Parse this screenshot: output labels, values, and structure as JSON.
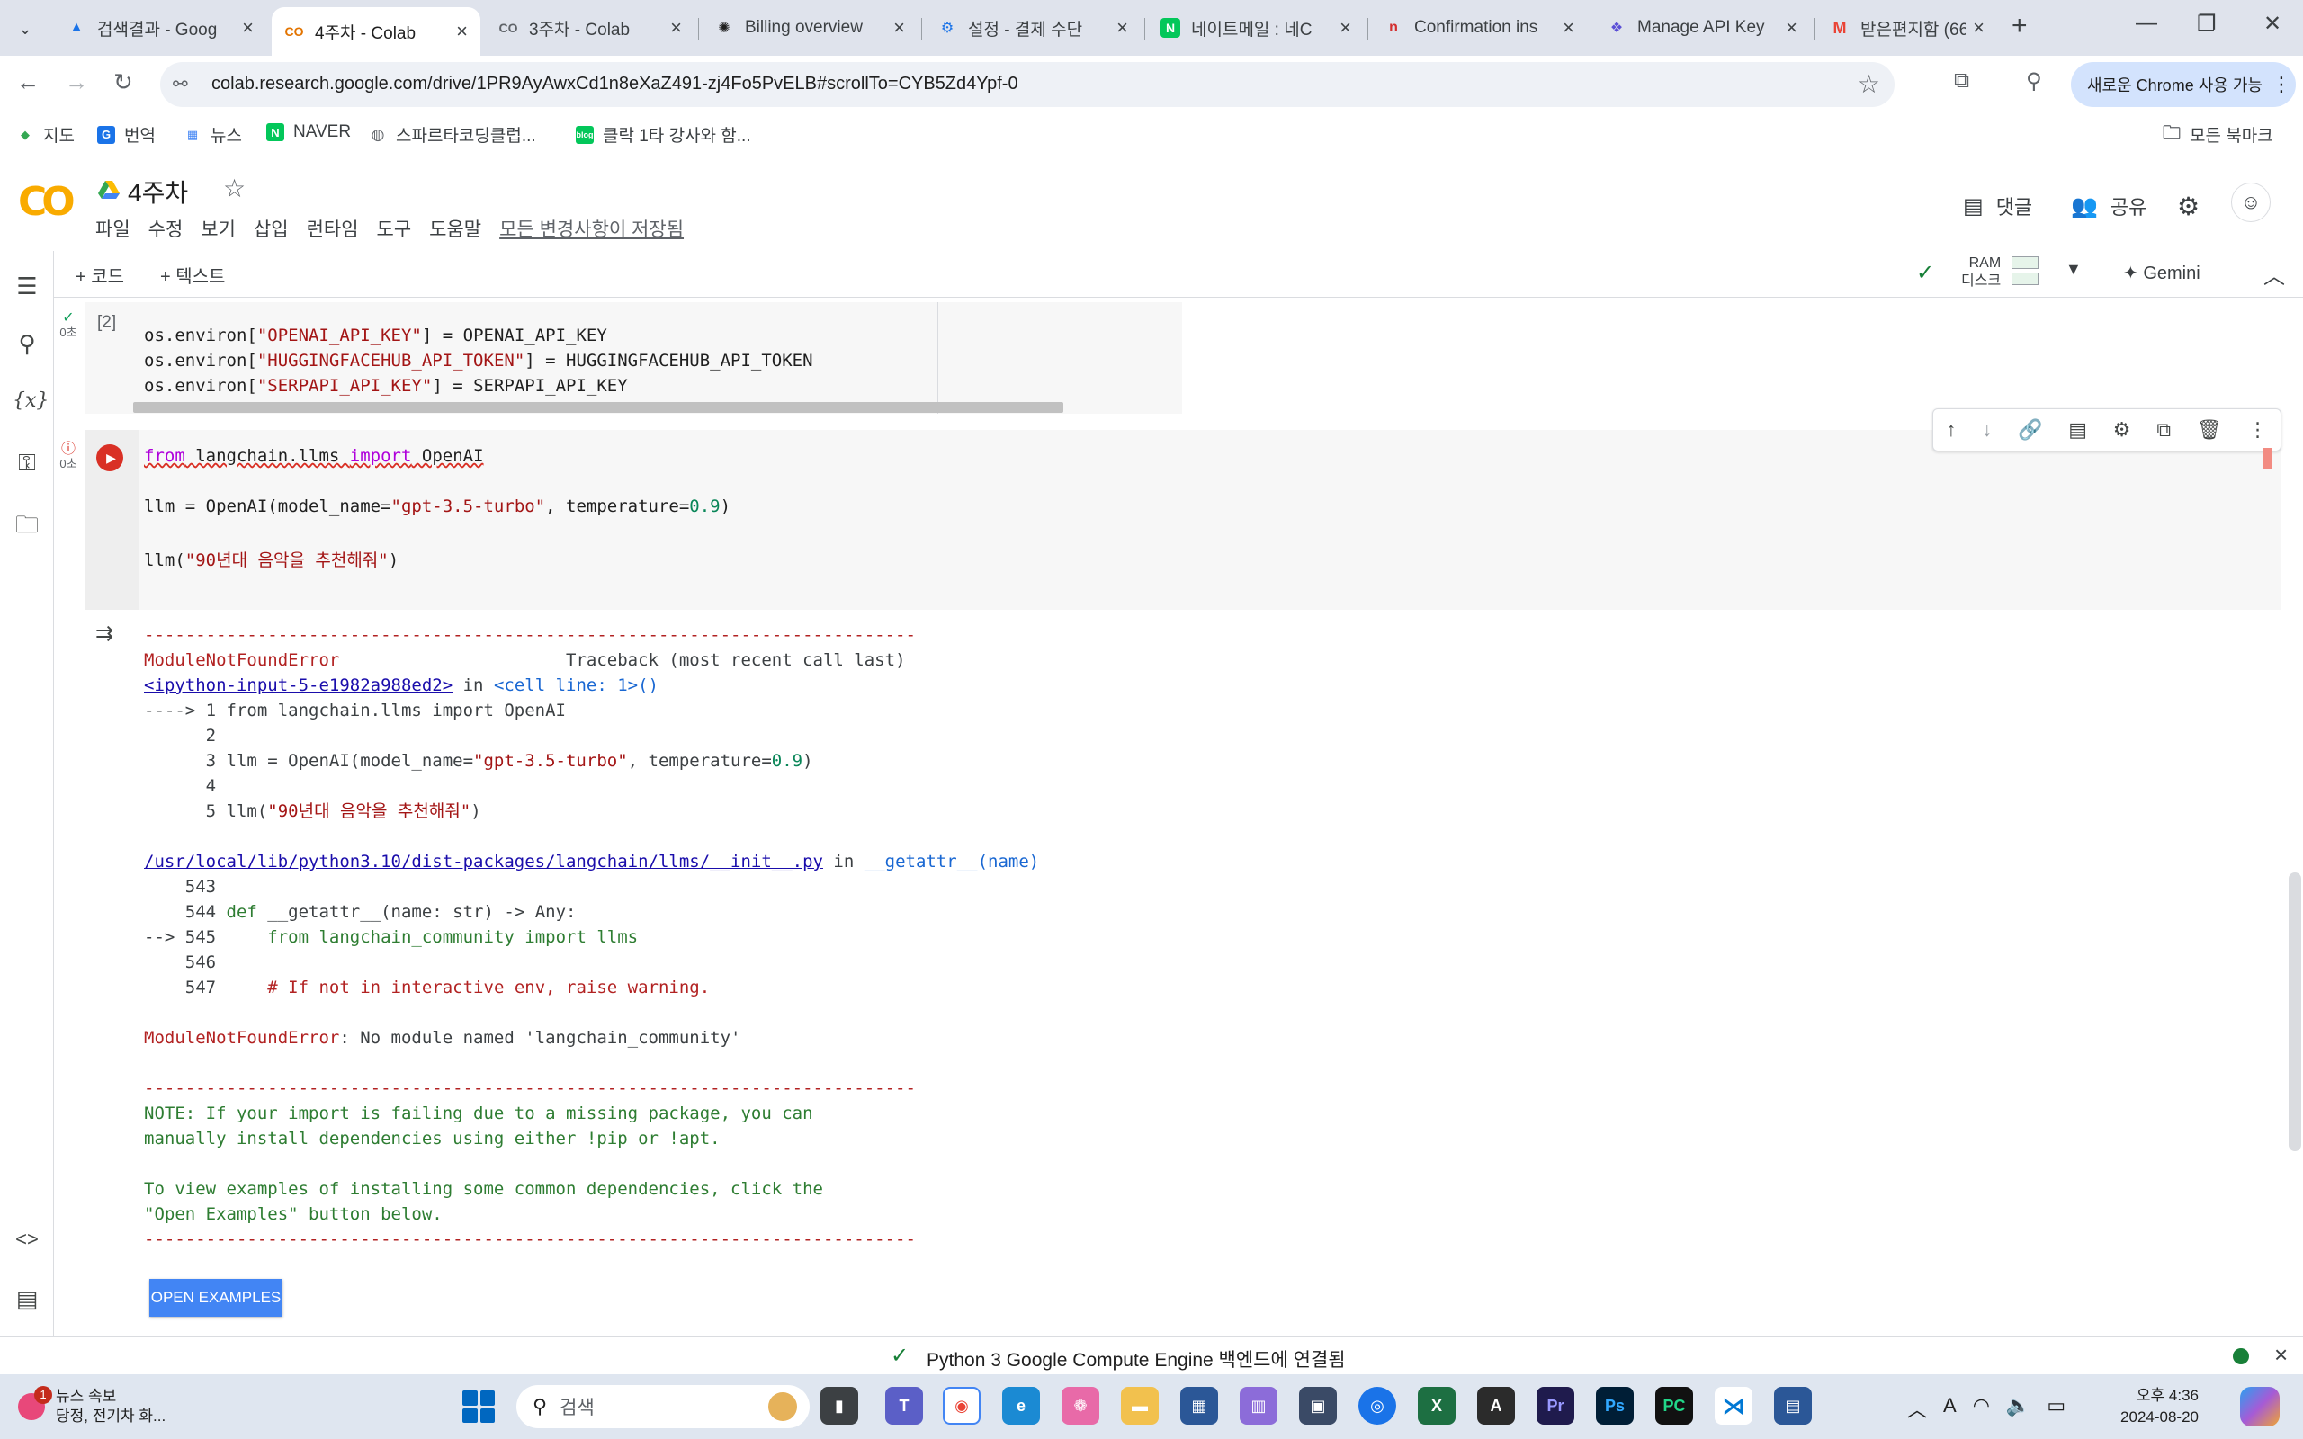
{
  "browser": {
    "tabs": [
      {
        "title": "검색결과 - Goog",
        "icon": "google-drive-icon",
        "active": false
      },
      {
        "title": "4주차 - Colab",
        "icon": "colab-icon",
        "active": true
      },
      {
        "title": "3주차 - Colab",
        "icon": "colab-icon",
        "active": false
      },
      {
        "title": "Billing overview",
        "icon": "openai-icon",
        "active": false
      },
      {
        "title": "설정 - 결제 수단",
        "icon": "gear-icon",
        "active": false
      },
      {
        "title": "네이트메일 : 네C",
        "icon": "naver-icon",
        "active": false
      },
      {
        "title": "Confirmation ins",
        "icon": "notion-icon",
        "active": false
      },
      {
        "title": "Manage API Key",
        "icon": "api-icon",
        "active": false
      },
      {
        "title": "받은편지함 (66)",
        "icon": "gmail-icon",
        "active": false
      }
    ],
    "url": "colab.research.google.com/drive/1PR9AyAwxCd1n8eXaZ491-zj4Fo5PvELB#scrollTo=CYB5Zd4Ypf-0",
    "new_chrome_label": "새로운 Chrome 사용 가능",
    "bookmarks": [
      {
        "label": "지도",
        "icon": "maps-icon"
      },
      {
        "label": "번역",
        "icon": "translate-icon"
      },
      {
        "label": "뉴스",
        "icon": "news-icon"
      },
      {
        "label": "NAVER",
        "icon": "naver-icon"
      },
      {
        "label": "스파르타코딩클럽...",
        "icon": "globe-icon"
      },
      {
        "label": "클락 1타 강사와 함...",
        "icon": "blog-icon"
      }
    ],
    "all_bookmarks_label": "모든 북마크"
  },
  "colab": {
    "logo": "CO",
    "title": "4주차",
    "menu": [
      "파일",
      "수정",
      "보기",
      "삽입",
      "런타임",
      "도구",
      "도움말"
    ],
    "saved_status": "모든 변경사항이 저장됨",
    "comment_label": "댓글",
    "share_label": "공유",
    "add_code_label": "+ 코드",
    "add_text_label": "+ 텍스트",
    "ram_label": "RAM",
    "disk_label": "디스크",
    "gemini_label": "Gemini"
  },
  "cells": {
    "cell1": {
      "count": "[2]",
      "time": "0초",
      "lines": [
        {
          "prefix": "os.environ[",
          "str": "\"OPENAI_API_KEY\"",
          "suffix": "] = OPENAI_API_KEY"
        },
        {
          "prefix": "os.environ[",
          "str": "\"HUGGINGFACEHUB_API_TOKEN\"",
          "suffix": "] = HUGGINGFACEHUB_API_TOKEN"
        },
        {
          "prefix": "os.environ[",
          "str": "\"SERPAPI_API_KEY\"",
          "suffix": "] = SERPAPI_API_KEY"
        }
      ]
    },
    "cell2": {
      "time": "0초",
      "line1_kw1": "from",
      "line1_mod": " langchain.llms ",
      "line1_kw2": "import",
      "line1_name": " OpenAI",
      "line2_prefix": "llm = OpenAI(model_name=",
      "line2_str": "\"gpt-3.5-turbo\"",
      "line2_mid": ", temperature=",
      "line2_num": "0.9",
      "line2_end": ")",
      "line3_prefix": "llm(",
      "line3_str": "\"90년대 음악을 추천해줘\"",
      "line3_end": ")"
    }
  },
  "output": {
    "dashes": "---------------------------------------------------------------------------",
    "error_name": "ModuleNotFoundError",
    "traceback_label": "Traceback (most recent call last)",
    "input_link": "<ipython-input-5-e1982a988ed2>",
    "in_text": " in ",
    "cell_line": "<cell line: 1>()",
    "tb1": [
      "----> 1 from langchain.llms import OpenAI",
      "      2",
      "      3 llm = OpenAI(model_name=",
      "      4",
      "      5 llm("
    ],
    "tb1_line3_str": "\"gpt-3.5-turbo\"",
    "tb1_line3_mid": ", temperature=",
    "tb1_line3_num": "0.9",
    "tb1_line3_end": ")",
    "tb1_line5_str": "\"90년대 음악을 추천해줘\"",
    "tb1_line5_end": ")",
    "file_link": "/usr/local/lib/python3.10/dist-packages/langchain/llms/__init__.py",
    "getattr": "__getattr__(name)",
    "tb2_543": "    543",
    "tb2_544_a": "    544 ",
    "tb2_544_def": "def",
    "tb2_544_b": " __getattr__(name: str) -> Any:",
    "tb2_545_a": "--> 545     ",
    "tb2_545_b": "from langchain_community import llms",
    "tb2_546": "    546",
    "tb2_547_a": "    547     ",
    "tb2_547_b": "# If not in interactive env, raise warning.",
    "final_error_name": "ModuleNotFoundError",
    "final_error_msg": ": No module named 'langchain_community'",
    "note1": "NOTE: If your import is failing due to a missing package, you can",
    "note2": "manually install dependencies using either !pip or !apt.",
    "note3": "To view examples of installing some common dependencies, click the",
    "note4": "\"Open Examples\" button below.",
    "open_examples_label": "OPEN EXAMPLES"
  },
  "statusbar": {
    "text": "Python 3 Google Compute Engine 백엔드에 연결됨"
  },
  "taskbar": {
    "news_title": "뉴스 속보",
    "news_sub": "당정, 전기차 화...",
    "news_badge": "1",
    "search_placeholder": "검색",
    "time": "오후 4:36",
    "date": "2024-08-20"
  }
}
